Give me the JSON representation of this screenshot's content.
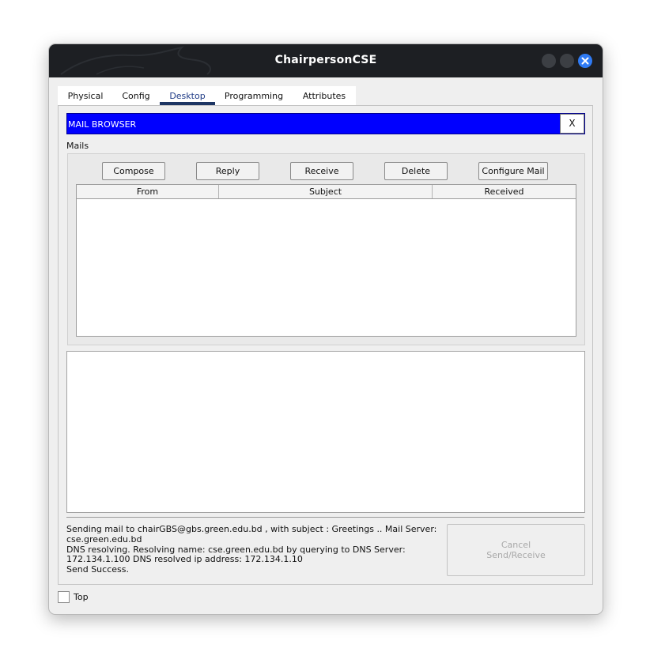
{
  "window": {
    "title": "ChairpersonCSE",
    "accent_color": "#2f7bf5"
  },
  "tabs": [
    {
      "label": "Physical",
      "active": false
    },
    {
      "label": "Config",
      "active": false
    },
    {
      "label": "Desktop",
      "active": true
    },
    {
      "label": "Programming",
      "active": false
    },
    {
      "label": "Attributes",
      "active": false
    }
  ],
  "mail_browser": {
    "title": "MAIL BROWSER",
    "close_label": "X",
    "title_color": "#0000ff",
    "mails_label": "Mails",
    "buttons": {
      "compose": "Compose",
      "reply": "Reply",
      "receive": "Receive",
      "delete": "Delete",
      "configure": "Configure Mail"
    },
    "table": {
      "columns": [
        "From",
        "Subject",
        "Received"
      ],
      "rows": []
    },
    "status_text": "Sending mail to chairGBS@gbs.green.edu.bd , with subject : Greetings ..   Mail Server: cse.green.edu.bd\nDNS resolving. Resolving name: cse.green.edu.bd by querying to DNS Server: 172.134.1.100  DNS resolved ip address: 172.134.1.10\nSend Success.",
    "cancel_button": "Cancel\nSend/Receive"
  },
  "footer": {
    "top_label": "Top",
    "top_checked": false
  }
}
